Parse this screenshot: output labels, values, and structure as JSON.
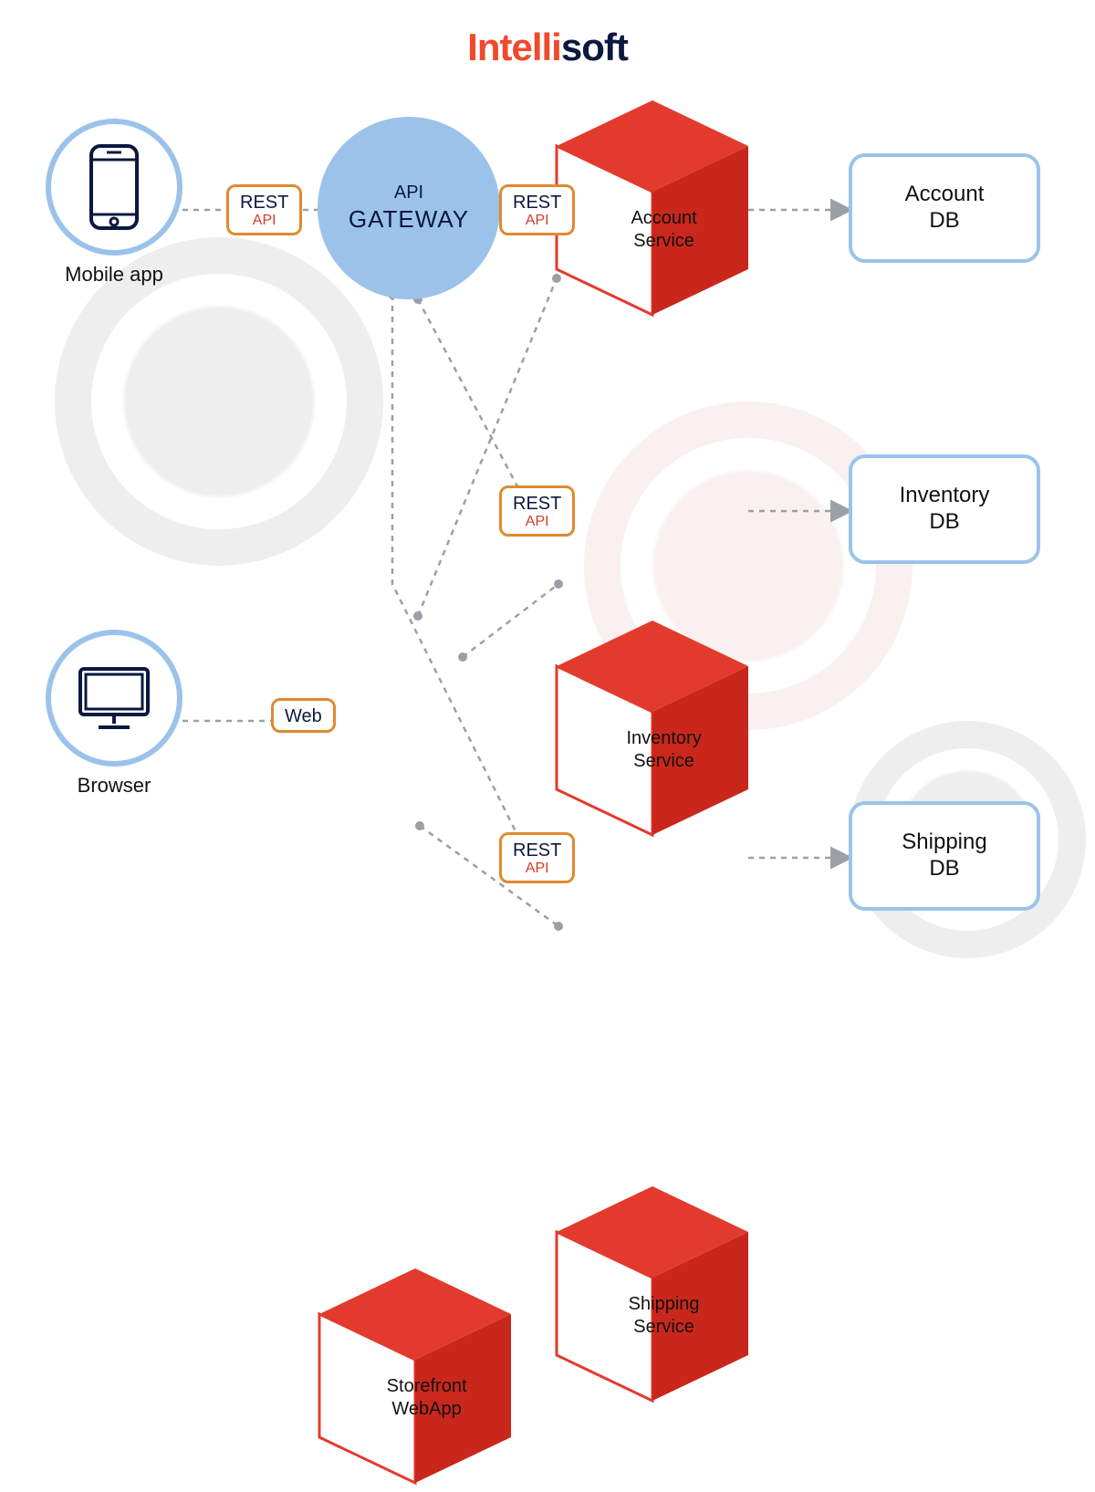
{
  "logo": {
    "part1": "Intelli",
    "part2": "soft"
  },
  "clients": {
    "mobile": {
      "label": "Mobile app"
    },
    "browser": {
      "label": "Browser"
    }
  },
  "gateway": {
    "line1": "API",
    "line2": "GATEWAY"
  },
  "badges": {
    "mobile_rest": {
      "line1": "REST",
      "line2": "API"
    },
    "gateway_rest": {
      "line1": "REST",
      "line2": "API"
    },
    "web": {
      "line1": "Web"
    },
    "inventory_rest": {
      "line1": "REST",
      "line2": "API"
    },
    "shipping_rest": {
      "line1": "REST",
      "line2": "API"
    }
  },
  "services": {
    "account": {
      "label_l1": "Account",
      "label_l2": "Service"
    },
    "inventory": {
      "label_l1": "Inventory",
      "label_l2": "Service"
    },
    "shipping": {
      "label_l1": "Shipping",
      "label_l2": "Service"
    },
    "storefront": {
      "label_l1": "Storefront",
      "label_l2": "WebApp"
    }
  },
  "databases": {
    "account": {
      "label_l1": "Account",
      "label_l2": "DB"
    },
    "inventory": {
      "label_l1": "Inventory",
      "label_l2": "DB"
    },
    "shipping": {
      "label_l1": "Shipping",
      "label_l2": "DB"
    }
  }
}
